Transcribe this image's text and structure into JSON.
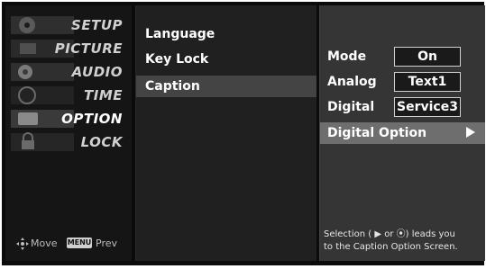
{
  "sidebar": {
    "items": [
      {
        "label": "SETUP",
        "icon": "film-reel-icon",
        "active": false
      },
      {
        "label": "PICTURE",
        "icon": "picture-icon",
        "active": false
      },
      {
        "label": "AUDIO",
        "icon": "speaker-icon",
        "active": false
      },
      {
        "label": "TIME",
        "icon": "clock-icon",
        "active": false
      },
      {
        "label": "OPTION",
        "icon": "option-icon",
        "active": true
      },
      {
        "label": "LOCK",
        "icon": "lock-icon",
        "active": false
      }
    ],
    "footer": {
      "move_label": "Move",
      "menu_badge": "MENU",
      "prev_label": "Prev"
    }
  },
  "middle_menu": {
    "items": [
      {
        "label": "Language",
        "selected": false
      },
      {
        "label": "Key Lock",
        "selected": false
      },
      {
        "label": "Caption",
        "selected": true
      }
    ]
  },
  "caption_panel": {
    "rows": [
      {
        "label": "Mode",
        "value": "On"
      },
      {
        "label": "Analog",
        "value": "Text1"
      },
      {
        "label": "Digital",
        "value": "Service3"
      }
    ],
    "digital_option": {
      "label": "Digital Option",
      "arrow_icon": "right-triangle-icon"
    },
    "help_line1": "Selection ( ▶ or ⦿) leads you",
    "help_line2": "to the Caption Option Screen."
  },
  "colors": {
    "background": "#0b0b0b",
    "panel": "#353535",
    "highlight": "#6e6e6e",
    "selected": "#444444"
  }
}
